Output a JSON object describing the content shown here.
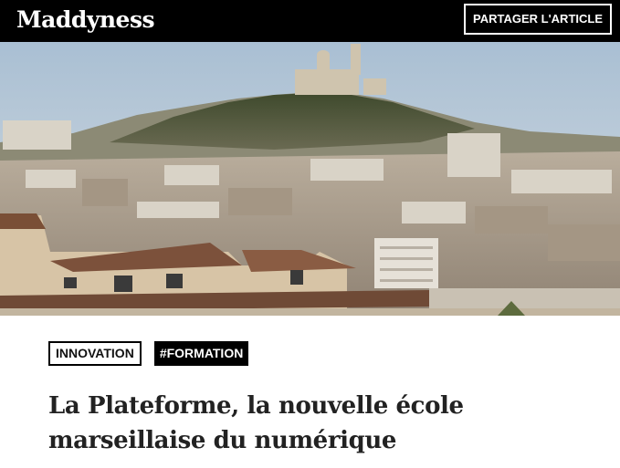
{
  "header": {
    "logo": "Maddyness",
    "share_label": "PARTAGER L'ARTICLE"
  },
  "hero": {
    "icon": "marseille-cityscape-photo"
  },
  "tags": [
    {
      "label": "INNOVATION"
    },
    {
      "label": "#FORMATION"
    }
  ],
  "article": {
    "title": "La Plateforme, la nouvelle école marseillaise du numérique"
  },
  "colors": {
    "header_bg": "#000000",
    "text": "#222222"
  }
}
